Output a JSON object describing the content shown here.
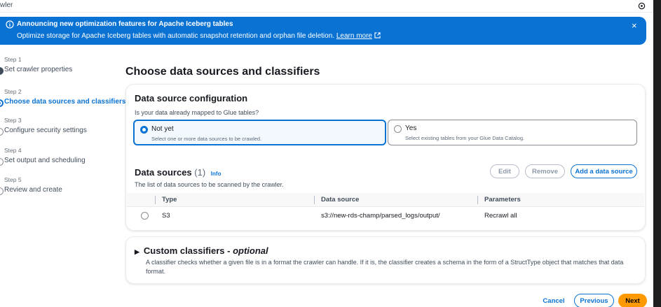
{
  "topbar": {
    "crumb": "wler"
  },
  "flash": {
    "title": "Announcing new optimization features for Apache Iceberg tables",
    "message": "Optimize storage for Apache Iceberg tables with automatic snapshot retention and orphan file deletion.",
    "link": "Learn more",
    "close": "×"
  },
  "steps": [
    {
      "num": "Step 1",
      "label": "Set crawler properties",
      "state": "done"
    },
    {
      "num": "Step 2",
      "label": "Choose data sources and classifiers",
      "state": "active"
    },
    {
      "num": "Step 3",
      "label": "Configure security settings",
      "state": "pending"
    },
    {
      "num": "Step 4",
      "label": "Set output and scheduling",
      "state": "pending"
    },
    {
      "num": "Step 5",
      "label": "Review and create",
      "state": "pending"
    }
  ],
  "page_title": "Choose data sources and classifiers",
  "config": {
    "title": "Data source configuration",
    "question": "Is your data already mapped to Glue tables?",
    "options": [
      {
        "title": "Not yet",
        "desc": "Select one or more data sources to be crawled.",
        "selected": true
      },
      {
        "title": "Yes",
        "desc": "Select existing tables from your Glue Data Catalog.",
        "selected": false
      }
    ]
  },
  "sources": {
    "title": "Data sources",
    "count": "(1)",
    "info": "Info",
    "desc": "The list of data sources to be scanned by the crawler.",
    "edit": "Edit",
    "remove": "Remove",
    "add": "Add a data source",
    "columns": [
      "Type",
      "Data source",
      "Parameters"
    ],
    "rows": [
      {
        "type": "S3",
        "source": "s3://new-rds-champ/parsed_logs/output/",
        "params": "Recrawl all"
      }
    ]
  },
  "classifiers": {
    "caret": "▶",
    "title": "Custom classifiers - ",
    "optional": "optional",
    "desc": "A classifier checks whether a given file is in a format the crawler can handle. If it is, the classifier creates a schema in the form of a StructType object that matches that data format."
  },
  "footer": {
    "cancel": "Cancel",
    "previous": "Previous",
    "next": "Next"
  },
  "colors": {
    "accent": "#0972d3",
    "primary": "#ff9900",
    "flash_bg": "#0972d3"
  }
}
